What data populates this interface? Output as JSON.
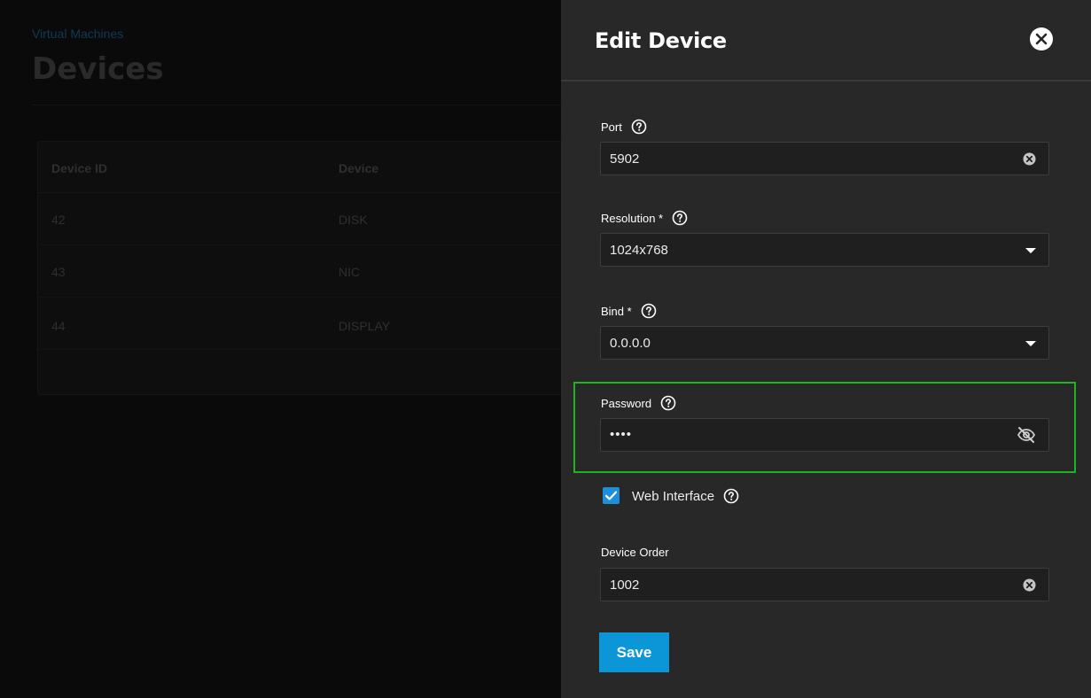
{
  "background": {
    "breadcrumb": "Virtual Machines",
    "title": "Devices",
    "table": {
      "columns": [
        "Device ID",
        "Device"
      ],
      "rows": [
        {
          "id": "42",
          "device": "DISK"
        },
        {
          "id": "43",
          "device": "NIC"
        },
        {
          "id": "44",
          "device": "DISPLAY"
        }
      ]
    }
  },
  "panel": {
    "title": "Edit Device",
    "close_icon": "close-icon",
    "fields": {
      "port": {
        "label": "Port",
        "value": "5902"
      },
      "resolution": {
        "label": "Resolution *",
        "value": "1024x768"
      },
      "bind": {
        "label": "Bind *",
        "value": "0.0.0.0"
      },
      "password": {
        "label": "Password",
        "value": "••••"
      },
      "web_interface": {
        "label": "Web Interface",
        "checked": true
      },
      "device_order": {
        "label": "Device Order",
        "value": "1002"
      }
    },
    "save_label": "Save"
  },
  "colors": {
    "accent": "#0b96d8",
    "checkbox": "#1d8fd8",
    "highlight": "#1fb31f",
    "panel_bg": "#282828"
  }
}
